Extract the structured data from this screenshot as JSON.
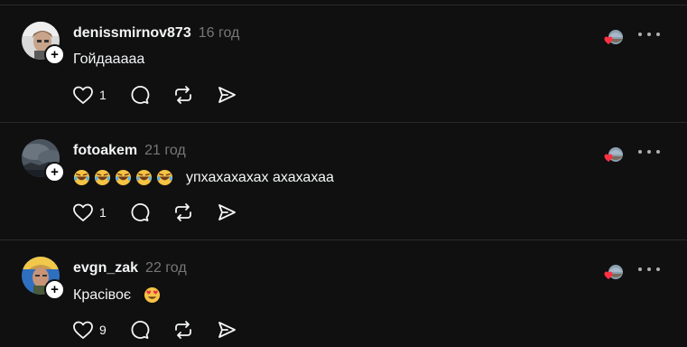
{
  "posts": [
    {
      "username": "denissmirnov873",
      "time": "16 год",
      "text": "Гойдааааа",
      "emoji_before": [],
      "emoji_after": [],
      "likes": "1",
      "avatar": "avatar-light-person"
    },
    {
      "username": "fotoakem",
      "time": "21 год",
      "text": "упхахахахах ахахахаа",
      "emoji_before": [
        "rolling-laughing-emoji",
        "rolling-laughing-emoji",
        "rolling-laughing-emoji",
        "rolling-laughing-emoji",
        "rolling-laughing-emoji"
      ],
      "emoji_after": [],
      "likes": "1",
      "avatar": "avatar-cloudy-sky"
    },
    {
      "username": "evgn_zak",
      "time": "22 год",
      "text": "Красівоє",
      "emoji_before": [],
      "emoji_after": [
        "heart-eyes-emoji"
      ],
      "likes": "9",
      "avatar": "avatar-yellow-blue"
    }
  ],
  "icons": {
    "like": "heart-icon",
    "reply": "comment-icon",
    "repost": "repost-icon",
    "share": "share-icon",
    "more": "more-icon",
    "follow": "plus-icon"
  },
  "colors": {
    "background": "#101010",
    "text": "#f3f5f7",
    "muted": "#777777",
    "divider": "#2a2a2a",
    "heart": "#ff3040"
  }
}
